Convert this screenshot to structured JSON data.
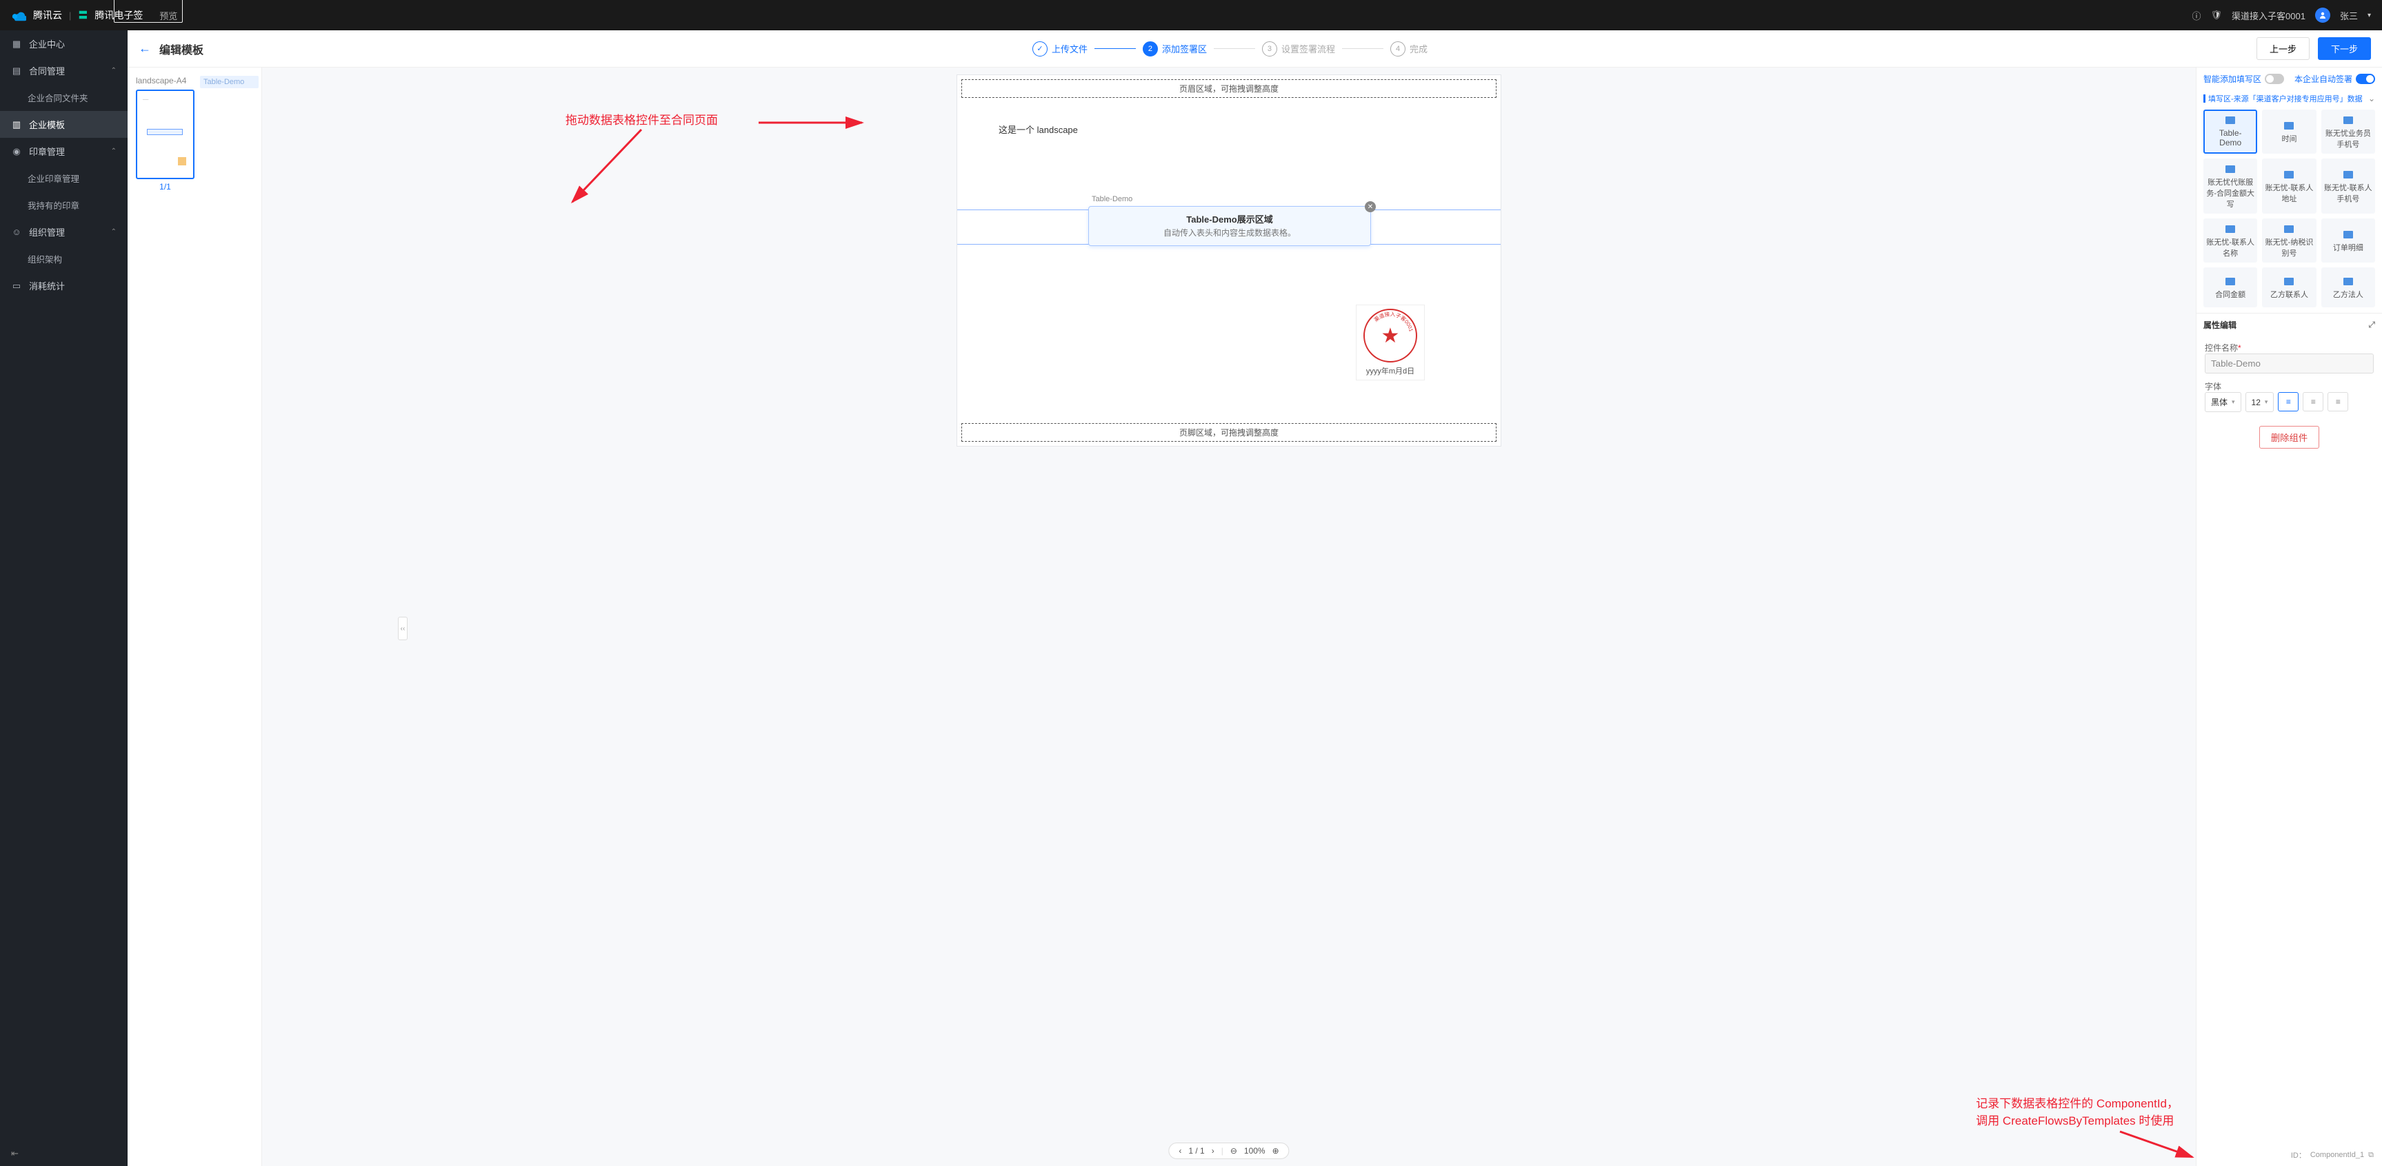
{
  "topbar": {
    "brand1": "腾讯云",
    "brand2": "腾讯电子签",
    "preview": "预览",
    "org": "渠道接入子客0001",
    "user": "张三"
  },
  "sidebar": {
    "items": [
      {
        "label": "企业中心"
      },
      {
        "label": "合同管理",
        "expand": true
      },
      {
        "label": "企业合同文件夹",
        "sub": true
      },
      {
        "label": "企业模板",
        "active": true
      },
      {
        "label": "印章管理",
        "expand": true
      },
      {
        "label": "企业印章管理",
        "sub": true
      },
      {
        "label": "我持有的印章",
        "sub": true
      },
      {
        "label": "组织管理",
        "expand": true
      },
      {
        "label": "组织架构",
        "sub": true
      },
      {
        "label": "消耗统计"
      }
    ]
  },
  "header": {
    "title": "编辑模板",
    "steps": [
      "上传文件",
      "添加签署区",
      "设置签署流程",
      "完成"
    ],
    "prev": "上一步",
    "next": "下一步"
  },
  "thumb": {
    "title": "landscape-A4",
    "pager": "1/1",
    "layers": [
      "Table-Demo",
      "印章"
    ]
  },
  "canvas": {
    "header_zone": "页眉区域，可拖拽调整高度",
    "footer_zone": "页脚区域，可拖拽调整高度",
    "body_text": "这是一个 landscape",
    "widget_tag": "Table-Demo",
    "widget_title": "Table-Demo展示区域",
    "widget_desc": "自动传入表头和内容生成数据表格。",
    "stamp_text": "渠道接入子客0001",
    "stamp_date": "yyyy年m月d日",
    "pager": "1 / 1",
    "zoom": "100%"
  },
  "annotations": {
    "a1": "拖动数据表格控件至合同页面",
    "a2_l1": "记录下数据表格控件的 ComponentId，",
    "a2_l2": "调用 CreateFlowsByTemplates 时使用"
  },
  "rpanel": {
    "toggle1": "智能添加填写区",
    "toggle2": "本企业自动签署",
    "source": "填写区-来源「渠道客户对接专用应用号」数据",
    "fields": [
      "Table-Demo",
      "时间",
      "账无忧业务员手机号",
      "账无忧代账服务-合同金额大写",
      "账无忧-联系人地址",
      "账无忧-联系人手机号",
      "账无忧-联系人名称",
      "账无忧-纳税识别号",
      "订单明细",
      "合同金额",
      "乙方联系人",
      "乙方法人"
    ],
    "prop_title": "属性编辑",
    "name_label": "控件名称",
    "name_value": "Table-Demo",
    "font_label": "字体",
    "font_family": "黑体",
    "font_size": "12",
    "delete": "删除组件",
    "id_label": "ID：",
    "id_value": "ComponentId_1"
  }
}
